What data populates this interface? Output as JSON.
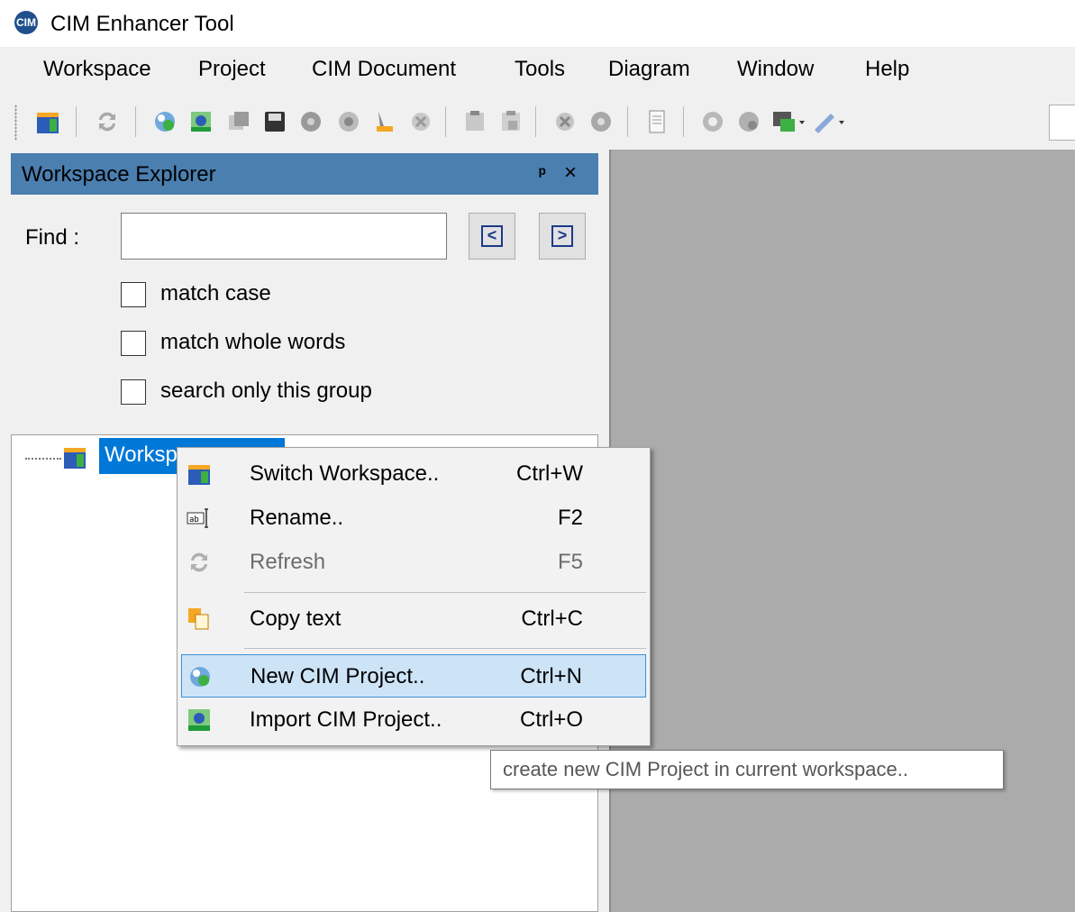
{
  "app": {
    "title": "CIM Enhancer Tool",
    "logo_text": "CIM"
  },
  "menu": [
    "Workspace",
    "Project",
    "CIM Document",
    "Tools",
    "Diagram",
    "Window",
    "Help"
  ],
  "toolbar": {
    "icons": [
      "workspace-icon",
      "refresh-icon",
      "new-project-icon",
      "import-project-icon",
      "copy-icon",
      "save-icon",
      "gear-disabled-icon",
      "cog-disabled-icon",
      "brush-disabled-icon",
      "settings-disabled-icon",
      "paste-icon",
      "paste-alt-icon",
      "gear-x-icon",
      "gear-star-icon",
      "document-icon",
      "settings-gear-icon",
      "settings-alt-icon",
      "export-dropdown-icon",
      "wrench-dropdown-icon"
    ]
  },
  "explorer": {
    "title": "Workspace Explorer",
    "pin": "ᵖ",
    "close": "×",
    "find_label": "Find :",
    "find_value": "",
    "prev": "<",
    "next": ">",
    "options": [
      "match case",
      "match whole words",
      "search only this group"
    ],
    "tree_node_label": "Worksp"
  },
  "context_menu": {
    "items": [
      {
        "label": "Switch Workspace..",
        "shortcut": "Ctrl+W"
      },
      {
        "label": "Rename..",
        "shortcut": "F2"
      },
      {
        "label": "Refresh",
        "shortcut": "F5"
      },
      {
        "label": "Copy text",
        "shortcut": "Ctrl+C"
      },
      {
        "label": "New CIM Project..",
        "shortcut": "Ctrl+N"
      },
      {
        "label": "Import CIM Project..",
        "shortcut": "Ctrl+O"
      }
    ]
  },
  "tooltip": "create new CIM Project in current workspace.."
}
